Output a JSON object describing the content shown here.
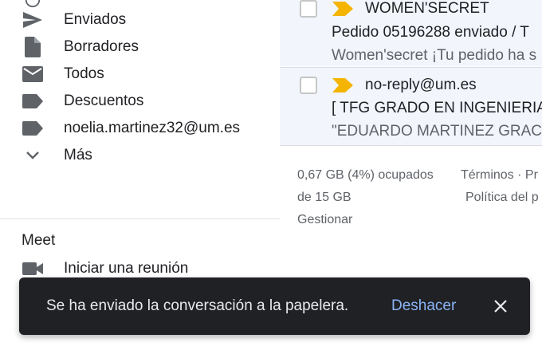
{
  "sidebar": {
    "items": [
      {
        "label": "Enviados",
        "icon": "send-icon"
      },
      {
        "label": "Borradores",
        "icon": "draft-icon"
      },
      {
        "label": "Todos",
        "icon": "mail-icon"
      },
      {
        "label": "Descuentos",
        "icon": "label-icon"
      },
      {
        "label": "noelia.martinez32@um.es",
        "icon": "label-icon"
      },
      {
        "label": "Más",
        "icon": "chevron-down-icon"
      }
    ]
  },
  "meet": {
    "title": "Meet",
    "start_label": "Iniciar una reunión"
  },
  "emails": [
    {
      "sender": "WOMEN'SECRET",
      "subject": "Pedido 05196288 enviado / T",
      "snippet": "Women'secret ¡Tu pedido ha s"
    },
    {
      "sender": "no-reply@um.es",
      "subject": "[ TFG GRADO EN INGENIERIA",
      "snippet": "\"EDUARDO MARTINEZ GRACI"
    }
  ],
  "footer": {
    "storage_used": "0,67 GB (4%) ocupados",
    "storage_total": "de 15 GB",
    "manage": "Gestionar",
    "terms": "Términos · Pr",
    "policy": "Política del p"
  },
  "snackbar": {
    "message": "Se ha enviado la conversación a la papelera.",
    "undo": "Deshacer"
  },
  "colors": {
    "accent": "#8ab4f8",
    "important_marker": "#f4b400",
    "snackbar_bg": "#202124",
    "row_bg": "#f2f6fc"
  }
}
